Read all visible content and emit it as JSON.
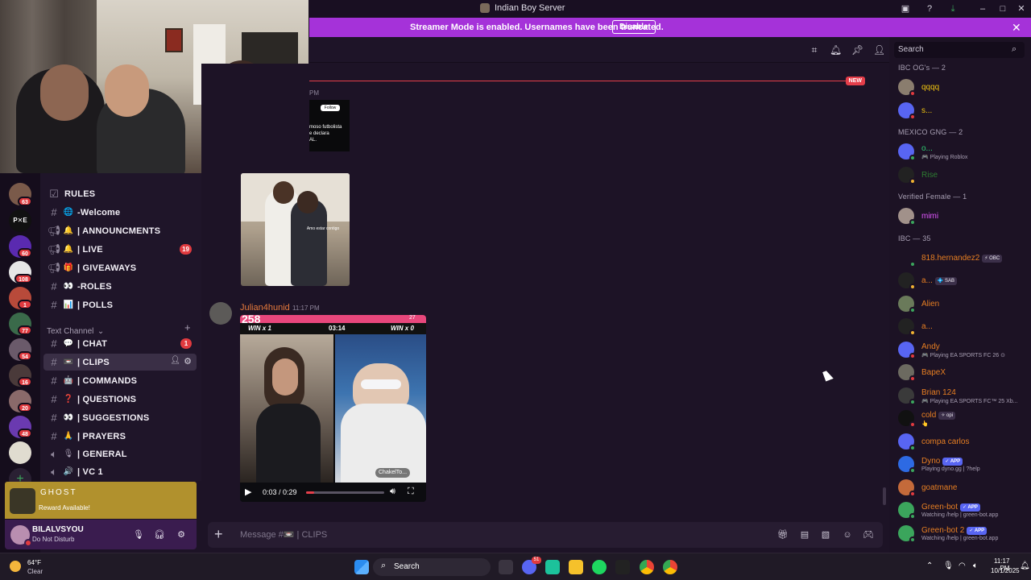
{
  "window": {
    "title": "Indian Boy Server"
  },
  "banner": {
    "message": "Streamer Mode is enabled. Usernames have been truncated.",
    "button": "Disable"
  },
  "rail": {
    "badges": [
      "63",
      "60",
      "108",
      "1",
      "77",
      "54",
      "16",
      "20",
      "48"
    ]
  },
  "channels": {
    "items": [
      {
        "emoji": "",
        "name": "RULES",
        "bold": true
      },
      {
        "emoji": "🌐",
        "name": "-Welcome",
        "bold": true
      },
      {
        "emoji": "🔔",
        "name": "| ANNOUNCMENTS",
        "bold": true
      },
      {
        "emoji": "🔔",
        "name": "| LIVE",
        "bold": true,
        "badge": "19"
      },
      {
        "emoji": "🎁",
        "name": "| GIVEAWAYS",
        "bold": true
      },
      {
        "emoji": "👀",
        "name": "-ROLES",
        "bold": true
      },
      {
        "emoji": "📊",
        "name": "| POLLS",
        "bold": true
      }
    ],
    "category": "Text Channel",
    "text_items": [
      {
        "emoji": "💬",
        "name": "| CHAT",
        "bold": true,
        "badge": "1"
      },
      {
        "emoji": "📼",
        "name": "| CLIPS",
        "bold": true,
        "active": true
      },
      {
        "emoji": "🤖",
        "name": "| COMMANDS",
        "bold": true
      },
      {
        "emoji": "❓",
        "name": "| QUESTIONS",
        "bold": true
      },
      {
        "emoji": "👀",
        "name": "| SUGGESTIONS",
        "bold": true
      },
      {
        "emoji": "🙏",
        "name": "| PRAYERS",
        "bold": true
      },
      {
        "emoji": "🎙",
        "name": "| GENERAL",
        "bold": true
      },
      {
        "emoji": "🔊",
        "name": "| VC 1",
        "bold": true
      }
    ]
  },
  "reward": {
    "title": "GHOST",
    "subtitle": "Reward Available!"
  },
  "user": {
    "name": "BILALVSYOU",
    "status": "Do Not Disturb"
  },
  "messages": {
    "new_tag": "NEW",
    "top_time": "PM",
    "tiktok_follow": "Follow",
    "tiktok_text": "moso futbolista\ne declara\nAL.",
    "kiss_caption": "Amo estar contigo",
    "author": "Julian4hunid",
    "time": "11:17 PM",
    "video": {
      "score": "258",
      "likes": "27",
      "win_left": "WIN x 1",
      "timer": "03:14",
      "win_right": "WIN x 0",
      "chip": "ChakelTo...",
      "time": "0:03 / 0:29",
      "progress": 0.1
    }
  },
  "composer": {
    "placeholder": "Message #📼 | CLIPS"
  },
  "members": {
    "search_placeholder": "Search",
    "groups": [
      {
        "title": "IBC OG's — 2",
        "members": [
          {
            "name": "qqqq",
            "color": "#f1c40f",
            "status": "#e03a3f",
            "av": "#8a7d6e"
          },
          {
            "name": "s...",
            "color": "#f1c40f",
            "status": "#e03a3f",
            "av": "#5865f2"
          }
        ]
      },
      {
        "title": "MEXICO GNG — 2",
        "members": [
          {
            "name": "o...",
            "color": "#2ecc71",
            "status": "#3ba55c",
            "av": "#5865f2",
            "activity": "🎮 Playing Roblox"
          },
          {
            "name": "Rise",
            "color": "#2e7d32",
            "status": "#f0b232",
            "av": "#222"
          }
        ]
      },
      {
        "title": "Verified Female — 1",
        "members": [
          {
            "name": "mimi",
            "color": "#e056fd",
            "status": "#3ba55c",
            "av": "#a1918a"
          }
        ]
      },
      {
        "title": "IBC — 35",
        "members": [
          {
            "name": "818.hernandez2",
            "color": "#e67e22",
            "status": "#3ba55c",
            "av": "#1c1224",
            "tag": "⚡ OBC"
          },
          {
            "name": "a...",
            "color": "#e67e22",
            "status": "#f0b232",
            "av": "#222",
            "tag": "💠 SAB"
          },
          {
            "name": "Alien",
            "color": "#e67e22",
            "status": "#3ba55c",
            "av": "#6a7a5a"
          },
          {
            "name": "a...",
            "color": "#e67e22",
            "status": "#f0b232",
            "av": "#222"
          },
          {
            "name": "Andy",
            "color": "#e67e22",
            "status": "#e03a3f",
            "av": "#5865f2",
            "activity": "🎮 Playing EA SPORTS FC 26 ⊙"
          },
          {
            "name": "BapeX",
            "color": "#e67e22",
            "status": "#e03a3f",
            "av": "#6c6a60"
          },
          {
            "name": "Brian 124",
            "color": "#e67e22",
            "status": "#3ba55c",
            "av": "#3a3a3a",
            "activity": "🎮 Playing EA SPORTS FC™ 25 Xb..."
          },
          {
            "name": "cold",
            "color": "#e67e22",
            "status": "#e03a3f",
            "av": "#111",
            "tag": "✧ opi",
            "activity": "👆"
          },
          {
            "name": "compa carlos",
            "color": "#e67e22",
            "status": "#3ba55c",
            "av": "#5865f2"
          },
          {
            "name": "Dyno",
            "color": "#e67e22",
            "status": "#3ba55c",
            "av": "#2d6ae3",
            "app": "✓ APP",
            "activity": "Playing dyno.gg | ?help"
          },
          {
            "name": "goatmane",
            "color": "#e67e22",
            "status": "#e03a3f",
            "av": "#c46a3a"
          },
          {
            "name": "Green-bot",
            "color": "#e67e22",
            "status": "#3ba55c",
            "av": "#3ba55c",
            "app": "✓ APP",
            "activity": "Watching /help | green-bot.app"
          },
          {
            "name": "Green-bot 2",
            "color": "#e67e22",
            "status": "#3ba55c",
            "av": "#3ba55c",
            "app": "✓ APP",
            "activity": "Watching /help | green-bot.app"
          }
        ]
      }
    ]
  },
  "taskbar": {
    "temp": "64°F",
    "condition": "Clear",
    "search_placeholder": "Search",
    "time": "11:17 PM",
    "date": "10/1/2025",
    "discord_badge": "51"
  },
  "colors": {
    "accent_banner": "#a532d9",
    "unread_badge": "#e03a3f",
    "author_name": "#e67a3c"
  }
}
